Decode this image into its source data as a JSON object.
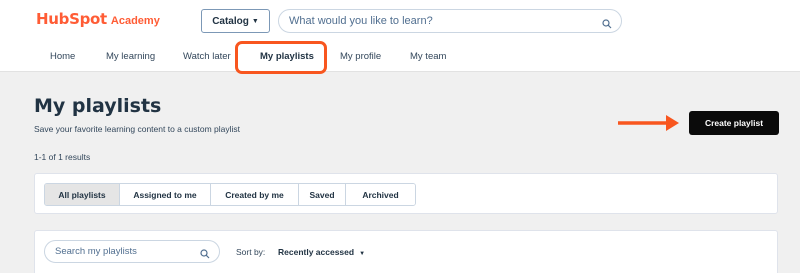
{
  "logo": {
    "brand": "HubSpot",
    "sub": "Academy"
  },
  "header": {
    "catalog_label": "Catalog",
    "search_placeholder": "What would you like to learn?"
  },
  "nav": {
    "items": [
      {
        "label": "Home"
      },
      {
        "label": "My learning"
      },
      {
        "label": "Watch later"
      },
      {
        "label": "My playlists"
      },
      {
        "label": "My profile"
      },
      {
        "label": "My team"
      }
    ],
    "active": "My playlists"
  },
  "page": {
    "title": "My playlists",
    "subtitle": "Save your favorite learning content to a custom playlist",
    "result_count": "1-1 of 1 results",
    "create_label": "Create playlist"
  },
  "filters": {
    "items": [
      {
        "label": "All playlists"
      },
      {
        "label": "Assigned to me"
      },
      {
        "label": "Created by me"
      },
      {
        "label": "Saved"
      },
      {
        "label": "Archived"
      }
    ],
    "selected": "All playlists"
  },
  "playlist_search": {
    "placeholder": "Search my playlists",
    "sort_label": "Sort by:",
    "sort_value": "Recently accessed"
  },
  "colors": {
    "brand": "#ff5c35",
    "highlight": "#f8561f",
    "primary_button": "#0b0b0b",
    "background": "#f0f0f0"
  },
  "icons": [
    "search-icon",
    "chevron-down-icon",
    "arrow-right-icon"
  ]
}
